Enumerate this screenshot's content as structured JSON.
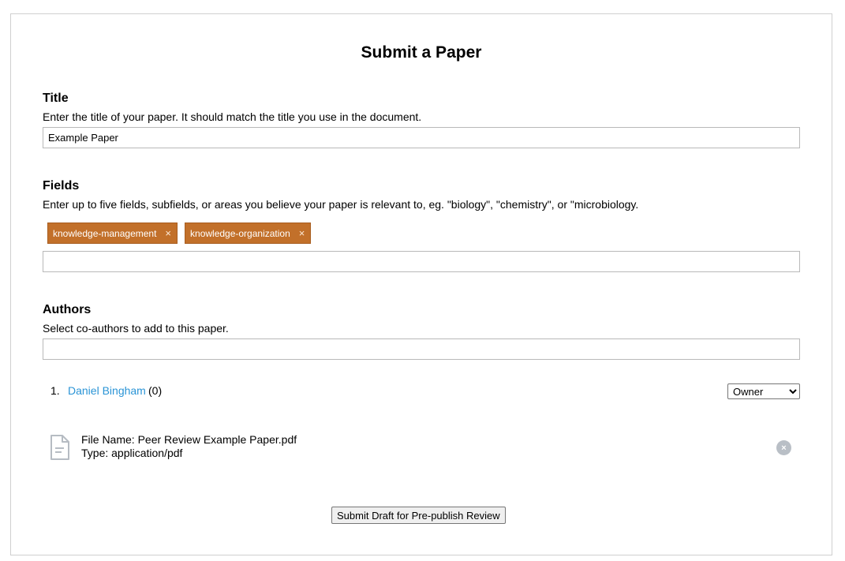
{
  "page": {
    "title": "Submit a Paper"
  },
  "title_section": {
    "heading": "Title",
    "help": "Enter the title of your paper. It should match the title you use in the document.",
    "value": "Example Paper"
  },
  "fields_section": {
    "heading": "Fields",
    "help": "Enter up to five fields, subfields, or areas you believe your paper is relevant to, eg. \"biology\", \"chemistry\", or \"microbiology.",
    "tags": [
      {
        "label": "knowledge-management",
        "remove": "×"
      },
      {
        "label": "knowledge-organization",
        "remove": "×"
      }
    ],
    "input_value": ""
  },
  "authors_section": {
    "heading": "Authors",
    "help": "Select co-authors to add to this paper.",
    "input_value": "",
    "authors": [
      {
        "index": "1.",
        "name": "Daniel Bingham",
        "count": "(0)",
        "role": "Owner"
      }
    ],
    "role_options": [
      "Owner"
    ]
  },
  "file": {
    "icon": "document-icon",
    "name": "File Name: Peer Review Example Paper.pdf",
    "type": "Type: application/pdf",
    "remove": "×"
  },
  "actions": {
    "submit_label": "Submit Draft for Pre-publish Review"
  },
  "colors": {
    "tag_background": "#c2702a",
    "link": "#2a94d6",
    "remove_file": "#b9bfc6"
  }
}
